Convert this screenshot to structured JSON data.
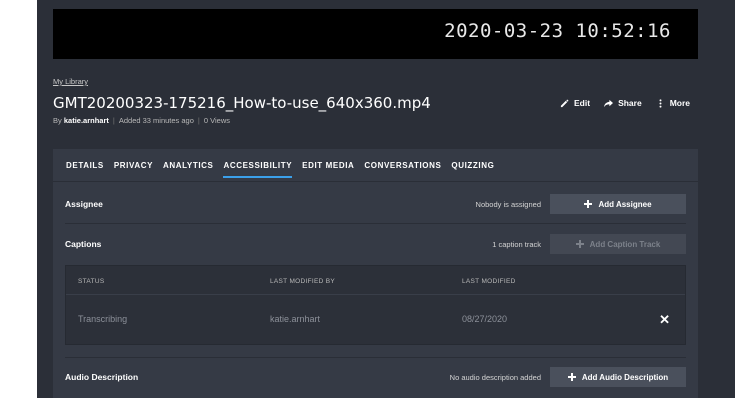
{
  "video": {
    "timestamp": "2020-03-23 10:52:16"
  },
  "header": {
    "breadcrumb": "My Library",
    "title": "GMT20200323-175216_How-to-use_640x360.mp4",
    "meta": {
      "by_prefix": "By",
      "author": "katie.arnhart",
      "added": "Added 33 minutes ago",
      "views": "0 Views"
    },
    "actions": {
      "edit": "Edit",
      "share": "Share",
      "more": "More"
    }
  },
  "tabs": [
    {
      "label": "DETAILS"
    },
    {
      "label": "PRIVACY"
    },
    {
      "label": "ANALYTICS"
    },
    {
      "label": "ACCESSIBILITY",
      "active": true
    },
    {
      "label": "EDIT MEDIA"
    },
    {
      "label": "CONVERSATIONS"
    },
    {
      "label": "QUIZZING"
    }
  ],
  "assignee": {
    "label": "Assignee",
    "status": "Nobody is assigned",
    "button": "Add Assignee"
  },
  "captions": {
    "label": "Captions",
    "status": "1 caption track",
    "button": "Add Caption Track",
    "table": {
      "headers": {
        "status": "STATUS",
        "modified_by": "LAST MODIFIED BY",
        "modified": "LAST MODIFIED"
      },
      "rows": [
        {
          "status": "Transcribing",
          "modified_by": "katie.arnhart",
          "modified": "08/27/2020"
        }
      ]
    }
  },
  "audio_description": {
    "label": "Audio Description",
    "status": "No audio description added",
    "button": "Add Audio Description"
  },
  "colors": {
    "accent": "#3ba0ea",
    "panel": "#353a45",
    "background": "#2b2f38"
  }
}
